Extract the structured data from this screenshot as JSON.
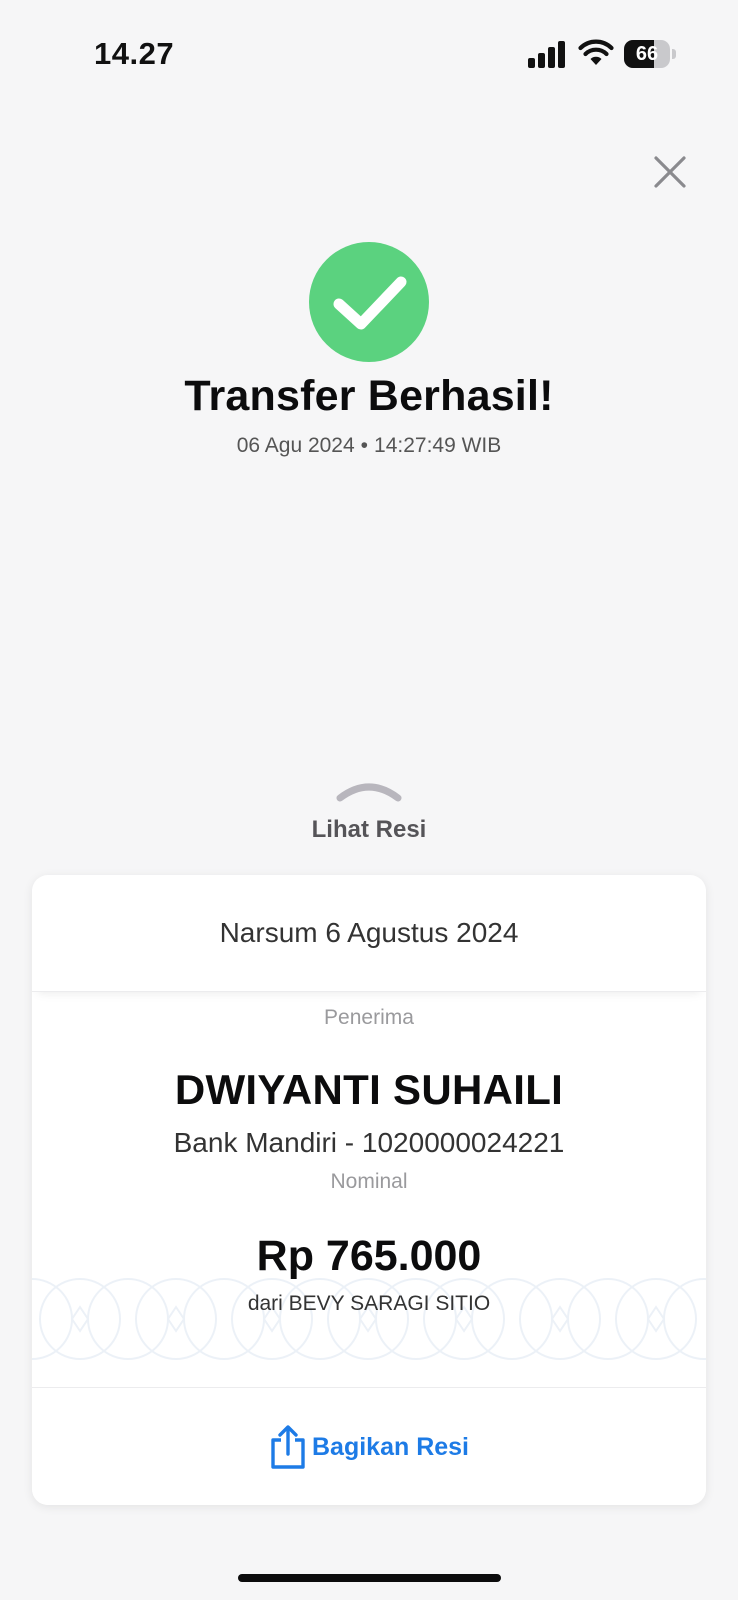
{
  "status_bar": {
    "time": "14.27",
    "battery_level": "66",
    "battery_fraction": 0.66,
    "icons": [
      "cellular-signal-icon",
      "wifi-icon",
      "battery-icon"
    ]
  },
  "colors": {
    "success_green": "#5bd27f",
    "accent_blue": "#1d7be6",
    "background": "#f6f6f7"
  },
  "header": {
    "close_icon": "close-icon"
  },
  "result": {
    "icon": "checkmark-icon",
    "title": "Transfer Berhasil!",
    "date": "06 Agu 2024",
    "separator": "•",
    "time": "14:27:49 WIB"
  },
  "receipt_toggle": {
    "icon": "chevron-up-icon",
    "label": "Lihat Resi"
  },
  "receipt": {
    "note": "Narsum 6 Agustus 2024",
    "recipient_label": "Penerima",
    "recipient_name": "DWIYANTI SUHAILI",
    "bank_account": "Bank Mandiri - 1020000024221",
    "amount_label": "Nominal",
    "amount": "Rp 765.000",
    "sender": "dari BEVY SARAGI SITIO",
    "share_icon": "share-icon",
    "share_label": "Bagikan Resi"
  }
}
